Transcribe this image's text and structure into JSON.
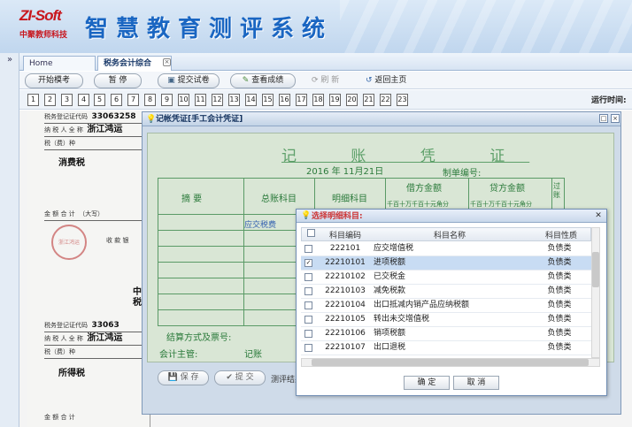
{
  "banner": {
    "logo": "ZI-Soft",
    "logo_sub": "中聚教师科技",
    "title": "智慧教育测评系统"
  },
  "tabs": {
    "home": "Home",
    "active": "税务会计综合"
  },
  "toolbar": {
    "start": "开始模考",
    "pause": "暂 停",
    "submit": "提交试卷",
    "view_score": "查看成绩",
    "refresh": "刷 新",
    "back_home": "返回主页"
  },
  "question_numbers": [
    "1",
    "2",
    "3",
    "4",
    "5",
    "6",
    "7",
    "8",
    "9",
    "10",
    "11",
    "12",
    "13",
    "14",
    "15",
    "16",
    "17",
    "18",
    "19",
    "20",
    "21",
    "22",
    "23"
  ],
  "runtime_label": "运行时间:",
  "scan": {
    "reg_code_label": "税务登记证代码",
    "reg_code": "33063258",
    "taxpayer_label": "纳 税 人 全 称",
    "taxpayer": "浙江鸿运",
    "type_label": "税（费）种",
    "consumption_tax": "消费税",
    "amount_label": "金 额 合 计",
    "amount_cap": "（大写）",
    "receiver": "收 款 银",
    "reg_code_2": "33063",
    "taxpayer_2": "浙江鸿运",
    "income_tax": "所得税",
    "mid_1": "中",
    "mid_2": "税",
    "bottom_label": "金 额 合 计",
    "stamp": "浙江鸿运"
  },
  "voucher": {
    "window_title": "记帐凭证[手工会计凭证]",
    "title": "记 账 凭 证",
    "date": "2016 年 11月21日",
    "voucher_no_label": "制单编号:",
    "col_summary": "摘  要",
    "col_general": "总账科目",
    "col_detail": "明细科目",
    "col_debit": "借方金额",
    "col_credit": "贷方金额",
    "col_post": "过账",
    "digits": [
      "千",
      "百",
      "十",
      "万",
      "千",
      "百",
      "十",
      "元",
      "角",
      "分"
    ],
    "entry_general": "应交税费",
    "settlement_label": "结算方式及票号:",
    "supervisor_label": "会计主管:",
    "bookkeeper_label": "记账",
    "save": "保 存",
    "submit": "提 交",
    "test_result": "测评结果"
  },
  "dialog": {
    "title": "选择明细科目:",
    "col_code": "科目编码",
    "col_name": "科目名称",
    "col_prop": "科目性质",
    "rows": [
      {
        "code": "222101",
        "name": "应交增值税",
        "prop": "负债类",
        "checked": false,
        "selected": false
      },
      {
        "code": "22210101",
        "name": "进项税额",
        "prop": "负债类",
        "checked": true,
        "selected": true
      },
      {
        "code": "22210102",
        "name": "已交税金",
        "prop": "负债类",
        "checked": false,
        "selected": false
      },
      {
        "code": "22210103",
        "name": "减免税款",
        "prop": "负债类",
        "checked": false,
        "selected": false
      },
      {
        "code": "22210104",
        "name": "出口抵减内销产品应纳税额",
        "prop": "负债类",
        "checked": false,
        "selected": false
      },
      {
        "code": "22210105",
        "name": "转出未交增值税",
        "prop": "负债类",
        "checked": false,
        "selected": false
      },
      {
        "code": "22210106",
        "name": "销项税额",
        "prop": "负债类",
        "checked": false,
        "selected": false
      },
      {
        "code": "22210107",
        "name": "出口退税",
        "prop": "负债类",
        "checked": false,
        "selected": false
      }
    ],
    "ok": "确 定",
    "cancel": "取 消"
  }
}
